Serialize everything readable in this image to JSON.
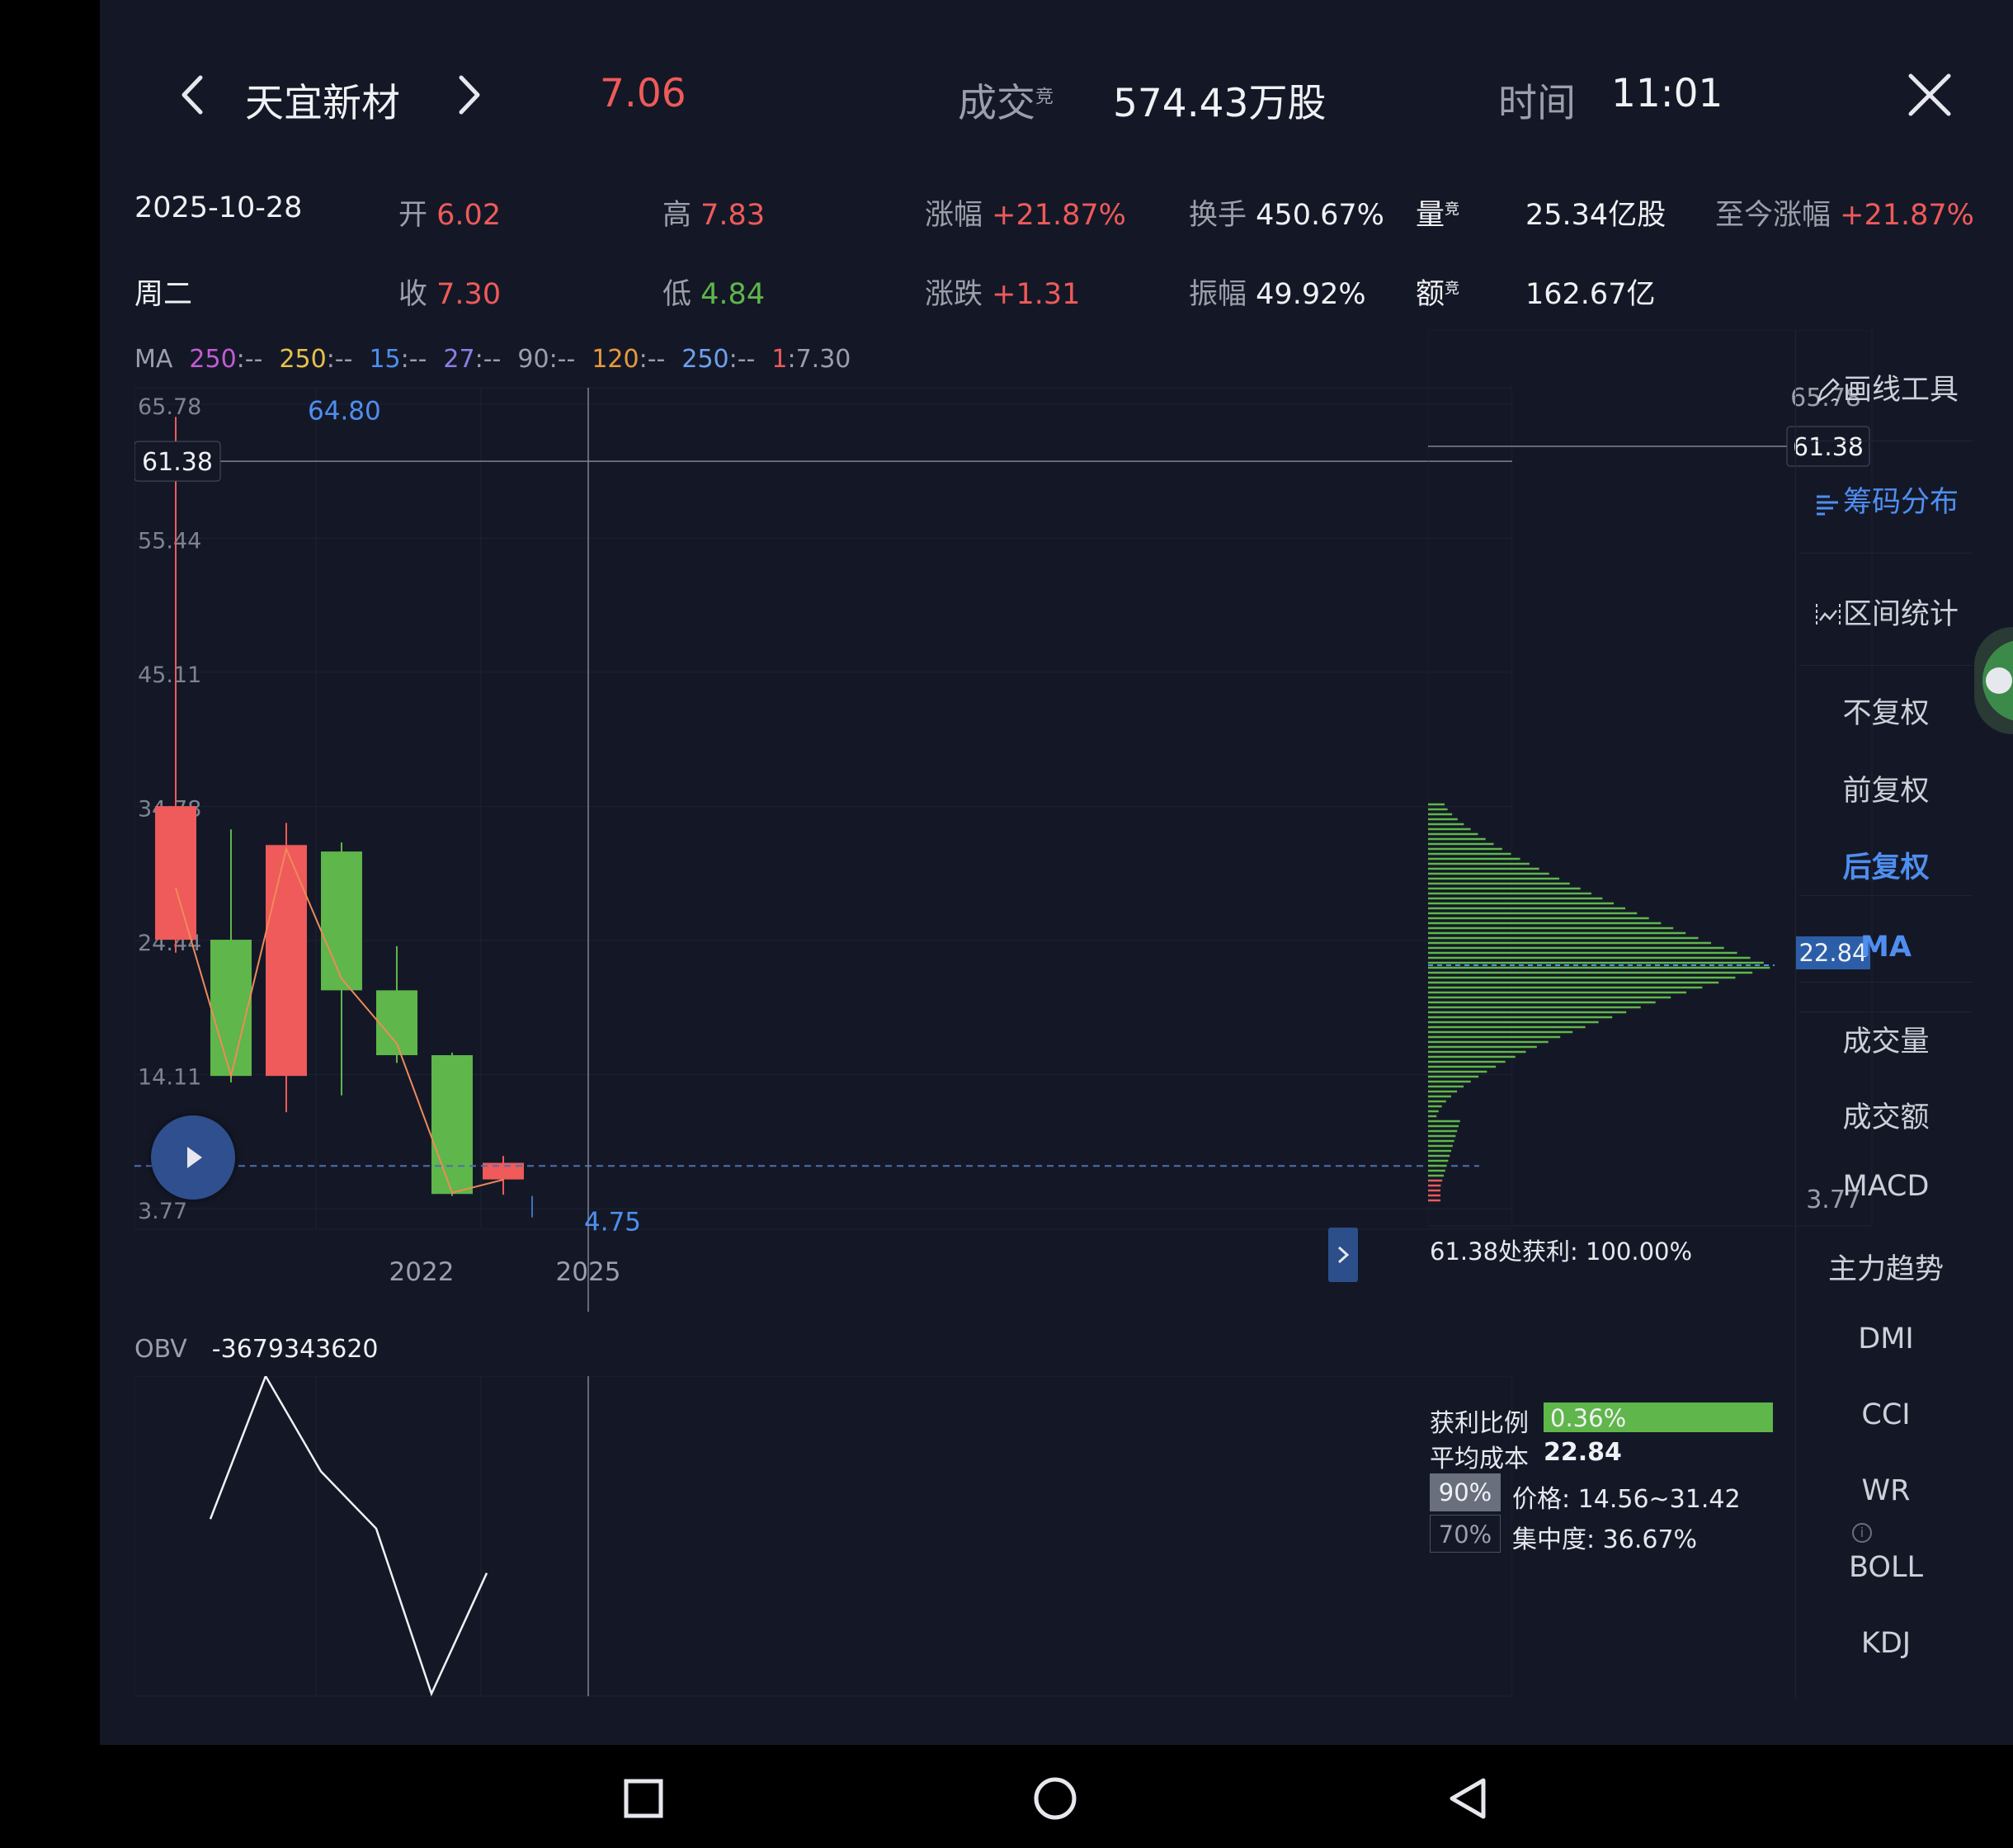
{
  "header": {
    "stock_name": "天宜新材",
    "price": "7.06",
    "volume_label": "成交",
    "volume_sup": "竞",
    "volume_value": "574.43万股",
    "time_label": "时间",
    "time_value": "11:01"
  },
  "stats": {
    "date": "2025-10-28",
    "weekday": "周二",
    "open_label": "开",
    "open_value": "6.02",
    "close_label": "收",
    "close_value": "7.30",
    "high_label": "高",
    "high_value": "7.83",
    "low_label": "低",
    "low_value": "4.84",
    "chg_pct_label": "涨幅",
    "chg_pct_value": "+21.87%",
    "chg_label": "涨跌",
    "chg_value": "+1.31",
    "turnover_label": "换手",
    "turnover_value": "450.67%",
    "amplitude_label": "振幅",
    "amplitude_value": "49.92%",
    "vol_label": "量",
    "vol_sup": "竞",
    "vol_value": "25.34亿股",
    "amt_label": "额",
    "amt_sup": "竞",
    "amt_value": "162.67亿",
    "since_label": "至今涨幅",
    "since_value": "+21.87%"
  },
  "ma_legend": [
    {
      "key": "MA",
      "val": "",
      "color": "#9a9fab"
    },
    {
      "key": "250",
      "val": ":--",
      "color": "#c25bd8"
    },
    {
      "key": "250",
      "val": ":--",
      "color": "#e8c14a"
    },
    {
      "key": "15",
      "val": ":--",
      "color": "#4f8ef0"
    },
    {
      "key": "27",
      "val": ":--",
      "color": "#8f7de8"
    },
    {
      "key": "90",
      "val": ":--",
      "color": "#9a9fab"
    },
    {
      "key": "120",
      "val": ":--",
      "color": "#e89a3c"
    },
    {
      "key": "250",
      "val": ":--",
      "color": "#6fa0f0"
    },
    {
      "key": "1",
      "val": ":7.30",
      "color": "#ef5a5a"
    }
  ],
  "kline": {
    "ytick_labels": [
      "65.78",
      "55.44",
      "45.11",
      "34.78",
      "24.44",
      "14.11",
      "3.77"
    ],
    "max_label": "64.80",
    "min_label": "4.75",
    "crosshair_price": "61.38",
    "x_labels": [
      "2022",
      "2025"
    ]
  },
  "chart_data": [
    {
      "type": "candlestick",
      "ylim": [
        3.77,
        65.78
      ],
      "x_tick_labels": [
        "2022",
        "2025"
      ],
      "candles": [
        {
          "open": 24.5,
          "close": 34.8,
          "high": 64.8,
          "low": 23.5
        },
        {
          "open": 24.5,
          "close": 14.0,
          "high": 33.0,
          "low": 13.5
        },
        {
          "open": 14.0,
          "close": 31.8,
          "high": 33.5,
          "low": 11.2
        },
        {
          "open": 31.3,
          "close": 20.6,
          "high": 32.0,
          "low": 12.5
        },
        {
          "open": 20.6,
          "close": 15.6,
          "high": 24.0,
          "low": 15.0
        },
        {
          "open": 15.6,
          "close": 4.9,
          "high": 15.8,
          "low": 4.75
        },
        {
          "open": 6.02,
          "close": 7.3,
          "high": 7.83,
          "low": 4.84
        }
      ],
      "ma_line": [
        28.5,
        14.0,
        31.5,
        21.5,
        16.5,
        5.0,
        6.0
      ]
    },
    {
      "type": "line",
      "title": "OBV",
      "values": [
        0.45,
        0.0,
        0.3,
        0.48,
        1.0,
        0.62
      ]
    }
  ],
  "obv": {
    "label": "OBV",
    "value": "-3679343620"
  },
  "chip": {
    "top_price": "65.78",
    "bottom_price": "3.77",
    "crosshair_price": "61.38",
    "avg_price_tag": "22.84",
    "profit_at_text": "61.38处获利: 100.00%",
    "profit_ratio_label": "获利比例",
    "profit_ratio_value": "0.36%",
    "profit_ratio_fraction": 0.0036,
    "avg_cost_label": "平均成本",
    "avg_cost_value": "22.84",
    "pct90": "90%",
    "price_range": "价格: 14.56~31.42",
    "pct70": "70%",
    "concentration": "集中度: 36.67%"
  },
  "toolbar": {
    "draw": "画线工具",
    "chip": "筹码分布",
    "interval": "区间统计",
    "items": [
      "不复权",
      "前复权",
      "后复权",
      "MA",
      "成交量",
      "成交额",
      "MACD",
      "主力趋势",
      "DMI",
      "CCI",
      "WR",
      "BOLL",
      "KDJ"
    ]
  },
  "colors": {
    "up": "#ef5a5a",
    "down": "#5fb64a",
    "accent": "#4f8ef0",
    "background": "#141826"
  }
}
